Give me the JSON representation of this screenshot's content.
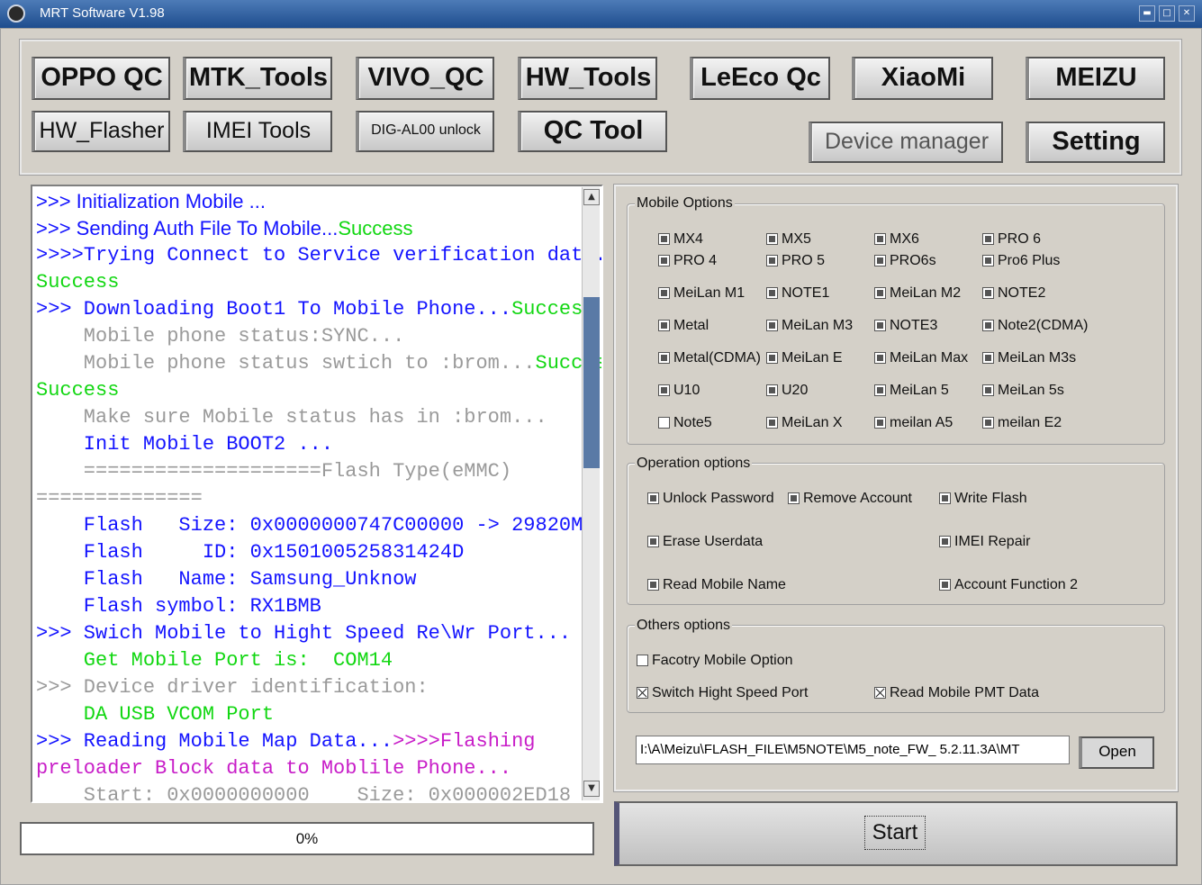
{
  "window": {
    "title": "MRT Software V1.98"
  },
  "toolbar": {
    "oppo_qc": "OPPO QC",
    "mtk_tools": "MTK_Tools",
    "vivo_qc": "VIVO_QC",
    "hw_tools": "HW_Tools",
    "leeco_qc": "LeEco Qc",
    "xiaomi": "XiaoMi",
    "meizu": "MEIZU",
    "hw_flasher": "HW_Flasher",
    "imei_tools": "IMEI Tools",
    "dig_unlock": "DIG-AL00 unlock",
    "qc_tool": "QC Tool",
    "device_manager": "Device manager",
    "setting": "Setting"
  },
  "log": {
    "lines": [
      {
        "a": ">>> Initialization Mobile ...",
        "b": ""
      },
      {
        "a": ">>> Sending Auth File To Mobile...",
        "b": "Success"
      },
      {
        "a": ">>>>Trying Connect to Service verification data...",
        "b": ""
      },
      {
        "a": "Success",
        "b": ""
      },
      {
        "a": ">>> Downloading Boot1 To Mobile Phone...",
        "b": "Success"
      },
      {
        "a": "    Mobile phone status:SYNC...",
        "b": ""
      },
      {
        "a": "    Mobile phone status swtich to :brom...",
        "b": "Success"
      },
      {
        "a": "Success",
        "b": ""
      },
      {
        "a": "    Make sure Mobile status has in :brom...",
        "b": ""
      },
      {
        "a": "    Init Mobile BOOT2 ...",
        "b": ""
      },
      {
        "a": "    ====================Flash Type(eMMC)",
        "b": ""
      },
      {
        "a": "==============",
        "b": ""
      },
      {
        "a": "    Flash   Size: 0x0000000747C00000 -> 29820M",
        "b": ""
      },
      {
        "a": "    Flash     ID: 0x150100525831424D",
        "b": ""
      },
      {
        "a": "    Flash   Name: Samsung_Unknow",
        "b": ""
      },
      {
        "a": "    Flash symbol: RX1BMB",
        "b": ""
      },
      {
        "a": ">>> Swich Mobile to Hight Speed Re\\Wr Port...",
        "b": ""
      },
      {
        "a": "    Get Mobile Port is:  COM14",
        "b": ""
      },
      {
        "a": ">>> Device driver identification:",
        "b": ""
      },
      {
        "a": "    DA USB VCOM Port",
        "b": ""
      },
      {
        "a": ">>> Reading Mobile Map Data...",
        "b": ">>>>Flashing"
      },
      {
        "a": "preloader Block data to Moblile Phone...",
        "b": ""
      },
      {
        "a": "    Start: 0x0000000000    Size: 0x000002ED18",
        "b": ""
      }
    ]
  },
  "progress": {
    "label": "0%",
    "value": 0
  },
  "mobile_options": {
    "legend": "Mobile Options",
    "items": [
      "MX4",
      "MX5",
      "MX6",
      "PRO 6",
      "PRO 4",
      "PRO 5",
      "PRO6s",
      "Pro6 Plus",
      "MeiLan M1",
      "NOTE1",
      "MeiLan M2",
      "NOTE2",
      "Metal",
      "MeiLan M3",
      "NOTE3",
      "Note2(CDMA)",
      "Metal(CDMA)",
      "MeiLan E",
      "MeiLan Max",
      "MeiLan M3s",
      "U10",
      "U20",
      "MeiLan 5",
      "MeiLan 5s",
      "Note5",
      "MeiLan X",
      "meilan A5",
      "meilan E2"
    ]
  },
  "operation_options": {
    "legend": "Operation options",
    "unlock_password": "Unlock Password",
    "remove_account": "Remove Account",
    "write_flash": "Write Flash",
    "erase_userdata": "Erase Userdata",
    "imei_repair": "IMEI Repair",
    "read_mobile_name": "Read Mobile Name",
    "account_function_2": "Account Function 2"
  },
  "others_options": {
    "legend": "Others options",
    "factory_mobile_option": "Facotry Mobile Option",
    "switch_high_speed_port": "Switch Hight Speed Port",
    "read_mobile_pmt_data": "Read Mobile PMT Data"
  },
  "file": {
    "path": "I:\\A\\Meizu\\FLASH_FILE\\M5NOTE\\M5_note_FW_ 5.2.11.3A\\MT",
    "open_label": "Open"
  },
  "start_label": "Start"
}
